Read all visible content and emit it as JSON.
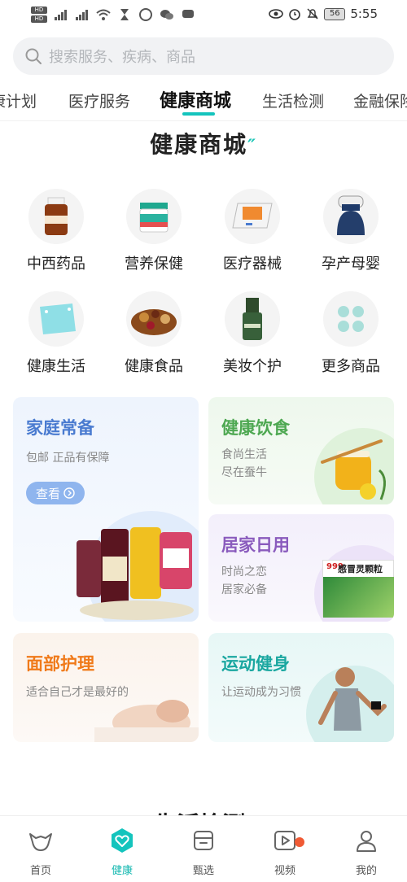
{
  "status_bar": {
    "time": "5:55",
    "battery": "56"
  },
  "search": {
    "placeholder": "搜索服务、疾病、商品"
  },
  "tabs": [
    {
      "label": "康计划"
    },
    {
      "label": "医疗服务"
    },
    {
      "label": "健康商城"
    },
    {
      "label": "生活检测"
    },
    {
      "label": "金融保险"
    }
  ],
  "section": {
    "title": "健康商城",
    "next_title": "生活检测"
  },
  "categories": [
    {
      "label": "中西药品",
      "icon": "medicine-bottle-icon"
    },
    {
      "label": "营养保健",
      "icon": "supplement-jar-icon"
    },
    {
      "label": "医疗器械",
      "icon": "blood-pressure-monitor-icon"
    },
    {
      "label": "孕产母婴",
      "icon": "breast-pump-icon"
    },
    {
      "label": "健康生活",
      "icon": "scale-icon"
    },
    {
      "label": "健康食品",
      "icon": "nuts-icon"
    },
    {
      "label": "美妆个护",
      "icon": "cosmetic-bottle-icon"
    },
    {
      "label": "更多商品",
      "icon": "more-grid-icon"
    }
  ],
  "cards": {
    "family": {
      "title": "家庭常备",
      "sub1": "包邮 正品有保障",
      "button": "查看",
      "color": "#4a7bd0"
    },
    "diet": {
      "title": "健康饮食",
      "sub1": "食尚生活",
      "sub2": "尽在蚕牛",
      "color": "#4ea852"
    },
    "home": {
      "title": "居家日用",
      "sub1": "时尚之恋",
      "sub2": "居家必备",
      "color": "#8a5bbd",
      "product": "感冒灵颗粒",
      "brand": "999"
    },
    "face": {
      "title": "面部护理",
      "sub1": "适合自己才是最好的",
      "color": "#f07a1a"
    },
    "sport": {
      "title": "运动健身",
      "sub1": "让运动成为习惯",
      "color": "#1aa7a0"
    }
  },
  "bottom_nav": [
    {
      "label": "首页",
      "icon": "home-icon"
    },
    {
      "label": "健康",
      "icon": "health-heart-icon"
    },
    {
      "label": "甄选",
      "icon": "shop-icon"
    },
    {
      "label": "视频",
      "icon": "video-icon"
    },
    {
      "label": "我的",
      "icon": "profile-icon"
    }
  ],
  "accent_color": "#14c4bd"
}
